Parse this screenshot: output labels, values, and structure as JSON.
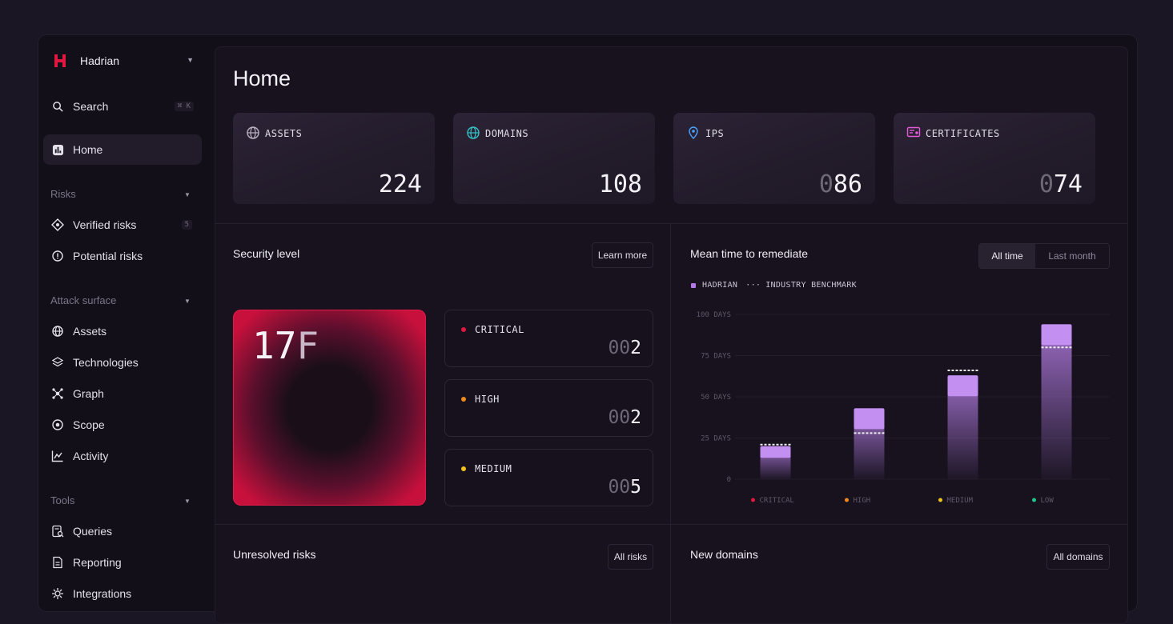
{
  "brand": {
    "name": "Hadrian",
    "colors": {
      "logo": "#e0173f"
    }
  },
  "sidebar": {
    "search": {
      "label": "Search",
      "shortcut": "⌘ K"
    },
    "home": {
      "label": "Home"
    },
    "sections": [
      {
        "title": "Risks",
        "items": [
          {
            "label": "Verified risks",
            "icon": "diamond-icon",
            "badge": "5"
          },
          {
            "label": "Potential risks",
            "icon": "alert-circle-icon"
          }
        ]
      },
      {
        "title": "Attack surface",
        "items": [
          {
            "label": "Assets",
            "icon": "globe-icon"
          },
          {
            "label": "Technologies",
            "icon": "layers-icon"
          },
          {
            "label": "Graph",
            "icon": "network-icon"
          },
          {
            "label": "Scope",
            "icon": "target-icon"
          },
          {
            "label": "Activity",
            "icon": "activity-icon"
          }
        ]
      },
      {
        "title": "Tools",
        "items": [
          {
            "label": "Queries",
            "icon": "query-icon"
          },
          {
            "label": "Reporting",
            "icon": "document-icon"
          },
          {
            "label": "Integrations",
            "icon": "integrations-icon"
          }
        ]
      }
    ]
  },
  "main": {
    "title": "Home",
    "stats": [
      {
        "label": "ASSETS",
        "dim": "",
        "value": "224",
        "icon": "assets-icon"
      },
      {
        "label": "DOMAINS",
        "dim": "",
        "value": "108",
        "icon": "globe-icon"
      },
      {
        "label": "IPS",
        "dim": "0",
        "value": "86",
        "icon": "location-pin-icon"
      },
      {
        "label": "CERTIFICATES",
        "dim": "0",
        "value": "74",
        "icon": "certificate-icon"
      }
    ],
    "security": {
      "title": "Security level",
      "learn_more": "Learn more",
      "grade_main": "17",
      "grade_suffix": "F",
      "severities": [
        {
          "label": "CRITICAL",
          "dim": "00",
          "value": "2",
          "color": "#e0173f"
        },
        {
          "label": "HIGH",
          "dim": "00",
          "value": "2",
          "color": "#f08a1c"
        },
        {
          "label": "MEDIUM",
          "dim": "00",
          "value": "5",
          "color": "#f0c21c"
        }
      ]
    },
    "mttr": {
      "title": "Mean time to remediate",
      "toggle": {
        "all_time": "All time",
        "last_month": "Last month"
      },
      "legend": {
        "hadrian": "HADRIAN",
        "benchmark": "INDUSTRY BENCHMARK"
      }
    },
    "unresolved": {
      "title": "Unresolved risks",
      "button": "All risks"
    },
    "new_domains": {
      "title": "New domains",
      "button": "All domains"
    }
  },
  "chart_data": {
    "type": "bar",
    "title": "Mean time to remediate",
    "categories": [
      "CRITICAL",
      "HIGH",
      "MEDIUM",
      "LOW"
    ],
    "category_colors": [
      "#e0173f",
      "#f08a1c",
      "#f0c21c",
      "#1fc68a"
    ],
    "series": [
      {
        "name": "HADRIAN",
        "values": [
          20,
          43,
          63,
          94
        ]
      },
      {
        "name": "INDUSTRY BENCHMARK",
        "values": [
          21,
          28,
          66,
          80
        ]
      }
    ],
    "yticks": [
      "100 DAYS",
      "75 DAYS",
      "50 DAYS",
      "25 DAYS",
      "0"
    ],
    "ylim": [
      0,
      100
    ]
  }
}
